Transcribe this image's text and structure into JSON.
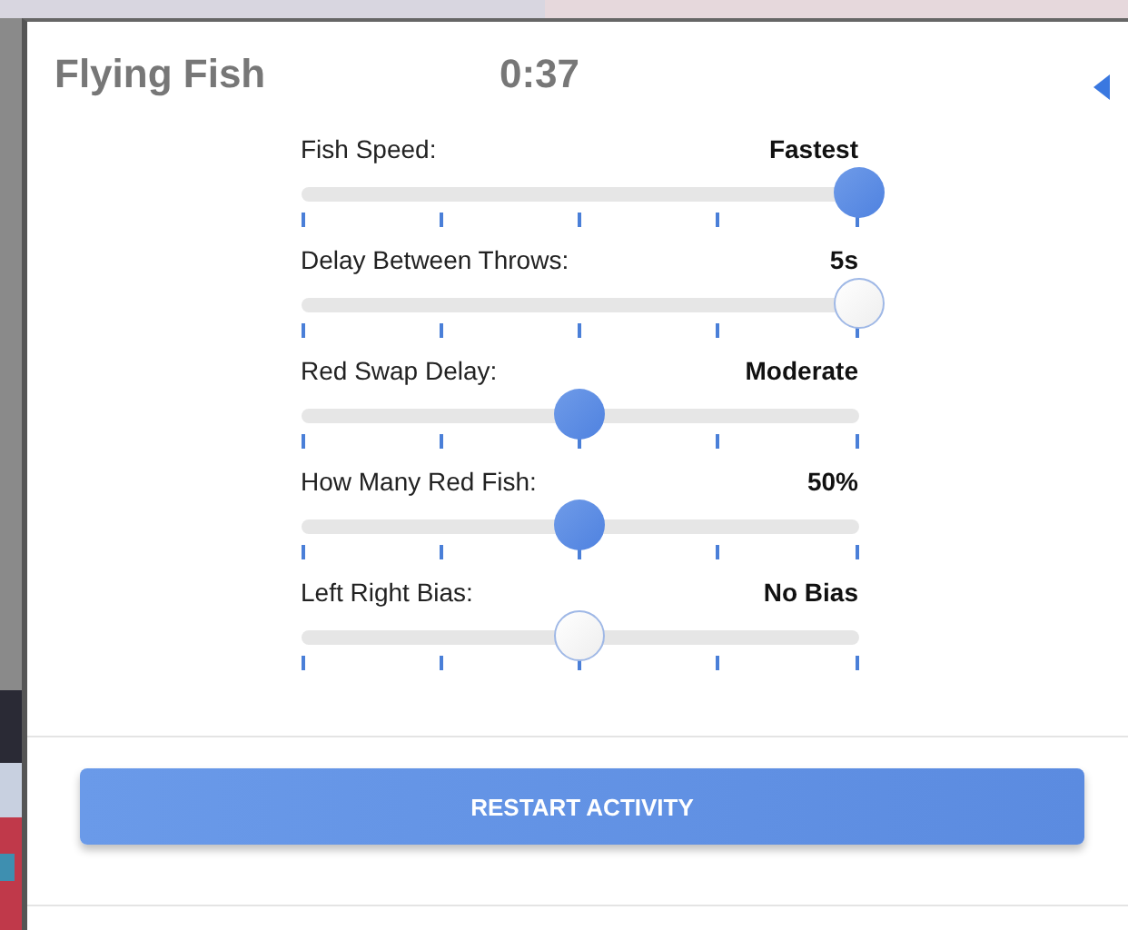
{
  "header": {
    "title": "Flying Fish",
    "timer": "0:37"
  },
  "sliders": [
    {
      "label": "Fish Speed:",
      "reading": "Fastest",
      "level": 1,
      "filled": true
    },
    {
      "label": "Delay Between Throws:",
      "reading": "5s",
      "level": 1,
      "filled": false
    },
    {
      "label": "Red Swap Delay:",
      "reading": "Moderate",
      "level": 0.5,
      "filled": true
    },
    {
      "label": "How Many Red Fish:",
      "reading": "50%",
      "level": 0.5,
      "filled": true
    },
    {
      "label": "Left Right Bias:",
      "reading": "No Bias",
      "level": 0.5,
      "filled": false
    }
  ],
  "restart_button": "RESTART ACTIVITY"
}
